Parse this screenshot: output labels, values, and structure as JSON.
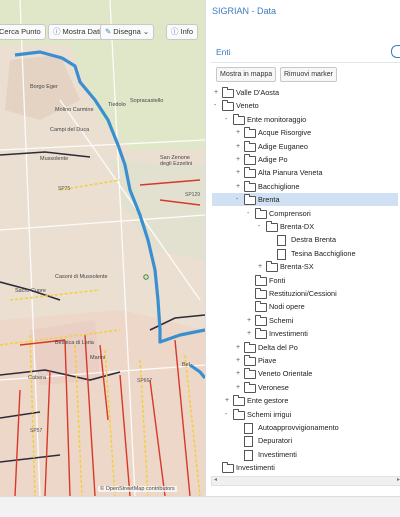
{
  "map": {
    "toolbar": {
      "cerca": "Cerca Punto",
      "mostra": "Mostra Dati",
      "disegna": "Disegna",
      "info": "Info"
    },
    "places": [
      "Borgo Eger",
      "Tiedolo",
      "Sopracastello",
      "Molino Carmine",
      "Campi del Duca",
      "Mussolente",
      "San Zenone degli Ezzelini",
      "Casoni di Mussolente",
      "Sacro Cuore",
      "Bessica di Loria",
      "Marini",
      "Cabera",
      "Bel"
    ],
    "roads": [
      "SP75",
      "SP129",
      "SP57",
      "SP667"
    ],
    "attribution": "© OpenStreetMap contributors"
  },
  "panel": {
    "title": "SIGRIAN - Data",
    "section": "Enti",
    "buttons": {
      "show": "Mostra in mappa",
      "remove": "Rimuovi marker"
    },
    "tree": [
      {
        "label": "Valle D'Aosta",
        "level": 1,
        "toggle": "+",
        "icon": "folder",
        "selected": false
      },
      {
        "label": "Veneto",
        "level": 1,
        "toggle": "-",
        "icon": "folder",
        "selected": false
      },
      {
        "label": "Ente monitoraggio",
        "level": 2,
        "toggle": "-",
        "icon": "folder",
        "selected": false
      },
      {
        "label": "Acque Risorgive",
        "level": 3,
        "toggle": "+",
        "icon": "folder",
        "selected": false
      },
      {
        "label": "Adige Euganeo",
        "level": 3,
        "toggle": "+",
        "icon": "folder",
        "selected": false
      },
      {
        "label": "Adige Po",
        "level": 3,
        "toggle": "+",
        "icon": "folder",
        "selected": false
      },
      {
        "label": "Alta Pianura Veneta",
        "level": 3,
        "toggle": "+",
        "icon": "folder",
        "selected": false
      },
      {
        "label": "Bacchiglione",
        "level": 3,
        "toggle": "+",
        "icon": "folder",
        "selected": false
      },
      {
        "label": "Brenta",
        "level": 3,
        "toggle": "-",
        "icon": "folder",
        "selected": true
      },
      {
        "label": "Comprensori",
        "level": 4,
        "toggle": "-",
        "icon": "folder",
        "selected": false
      },
      {
        "label": "Brenta-DX",
        "level": 5,
        "toggle": "-",
        "icon": "folder",
        "selected": false
      },
      {
        "label": "Destra Brenta",
        "level": 6,
        "toggle": "",
        "icon": "doc",
        "selected": false
      },
      {
        "label": "Tesina Bacchiglione",
        "level": 6,
        "toggle": "",
        "icon": "doc",
        "selected": false
      },
      {
        "label": "Brenta-SX",
        "level": 5,
        "toggle": "+",
        "icon": "folder",
        "selected": false
      },
      {
        "label": "Fonti",
        "level": 4,
        "toggle": "",
        "icon": "folder",
        "selected": false
      },
      {
        "label": "Restituzioni/Cessioni",
        "level": 4,
        "toggle": "",
        "icon": "folder",
        "selected": false
      },
      {
        "label": "Nodi opere",
        "level": 4,
        "toggle": "",
        "icon": "folder",
        "selected": false
      },
      {
        "label": "Schemi",
        "level": 4,
        "toggle": "+",
        "icon": "folder",
        "selected": false
      },
      {
        "label": "Investimenti",
        "level": 4,
        "toggle": "+",
        "icon": "folder",
        "selected": false
      },
      {
        "label": "Delta del Po",
        "level": 3,
        "toggle": "+",
        "icon": "folder",
        "selected": false
      },
      {
        "label": "Piave",
        "level": 3,
        "toggle": "+",
        "icon": "folder",
        "selected": false
      },
      {
        "label": "Veneto Orientale",
        "level": 3,
        "toggle": "+",
        "icon": "folder",
        "selected": false
      },
      {
        "label": "Veronese",
        "level": 3,
        "toggle": "+",
        "icon": "folder",
        "selected": false
      },
      {
        "label": "Ente gestore",
        "level": 2,
        "toggle": "+",
        "icon": "folder",
        "selected": false
      },
      {
        "label": "Schemi irrigui",
        "level": 2,
        "toggle": "-",
        "icon": "folder",
        "selected": false
      },
      {
        "label": "Autoapprovvigionamento",
        "level": 3,
        "toggle": "",
        "icon": "doc",
        "selected": false
      },
      {
        "label": "Depuratori",
        "level": 3,
        "toggle": "",
        "icon": "doc",
        "selected": false
      },
      {
        "label": "Investimenti",
        "level": 3,
        "toggle": "",
        "icon": "doc",
        "selected": false
      },
      {
        "label": "Investimenti",
        "level": 1,
        "toggle": "",
        "icon": "folder",
        "selected": false
      }
    ]
  },
  "colors": {
    "accent": "#3a7cc2",
    "boundary": "#3a8fd0",
    "canal": "#d9382a",
    "road": "#f4cf3a",
    "selected": "#cfe1f3"
  }
}
